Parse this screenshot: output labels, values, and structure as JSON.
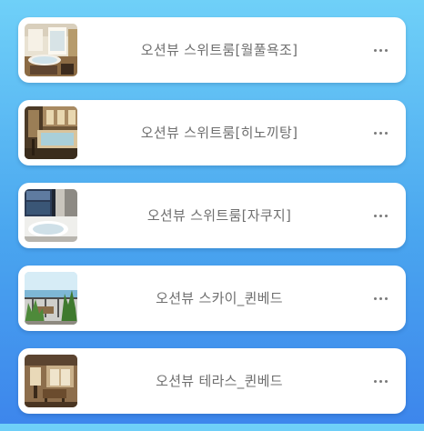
{
  "rooms": [
    {
      "name": "오션뷰 스위트룸[월풀욕조]",
      "more_icon": "more-horizontal-icon"
    },
    {
      "name": "오션뷰 스위트룸[히노끼탕]",
      "more_icon": "more-horizontal-icon"
    },
    {
      "name": "오션뷰 스위트룸[자쿠지]",
      "more_icon": "more-horizontal-icon"
    },
    {
      "name": "오션뷰 스카이_퀸베드",
      "more_icon": "more-horizontal-icon"
    },
    {
      "name": "오션뷰 테라스_퀸베드",
      "more_icon": "more-horizontal-icon"
    }
  ],
  "colors": {
    "background_top": "#6fd0f8",
    "background_bottom": "#3d86ec",
    "card": "#ffffff",
    "text": "#6f6f6f"
  }
}
